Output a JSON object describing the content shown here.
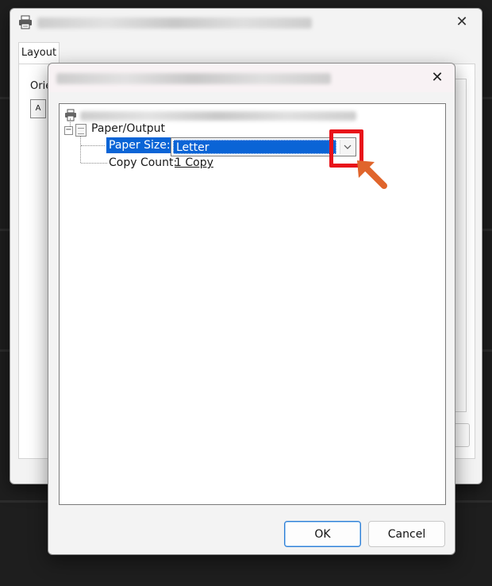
{
  "back_window": {
    "tab_layout": "Layout",
    "orientation_label": "Orie",
    "orientation_icon_glyph": "A"
  },
  "front_dialog": {
    "tree": {
      "group_label": "Paper/Output",
      "paper_size": {
        "label": "Paper Size:",
        "value": "Letter"
      },
      "copy_count": {
        "label": "Copy Count:",
        "value": "1 Copy"
      }
    },
    "buttons": {
      "ok_label": "OK",
      "cancel_label": "Cancel"
    }
  },
  "icons": {
    "printer": "printer-icon",
    "close": "close-icon",
    "expander": "tree-collapse-icon",
    "document": "document-icon",
    "dropdown": "chevron-down-icon",
    "pointer": "annotation-arrow-icon"
  },
  "colors": {
    "selection": "#0a64d6",
    "highlight": "#e8131a",
    "pointer": "#e0652c",
    "default_button_border": "#2e7fd6"
  }
}
